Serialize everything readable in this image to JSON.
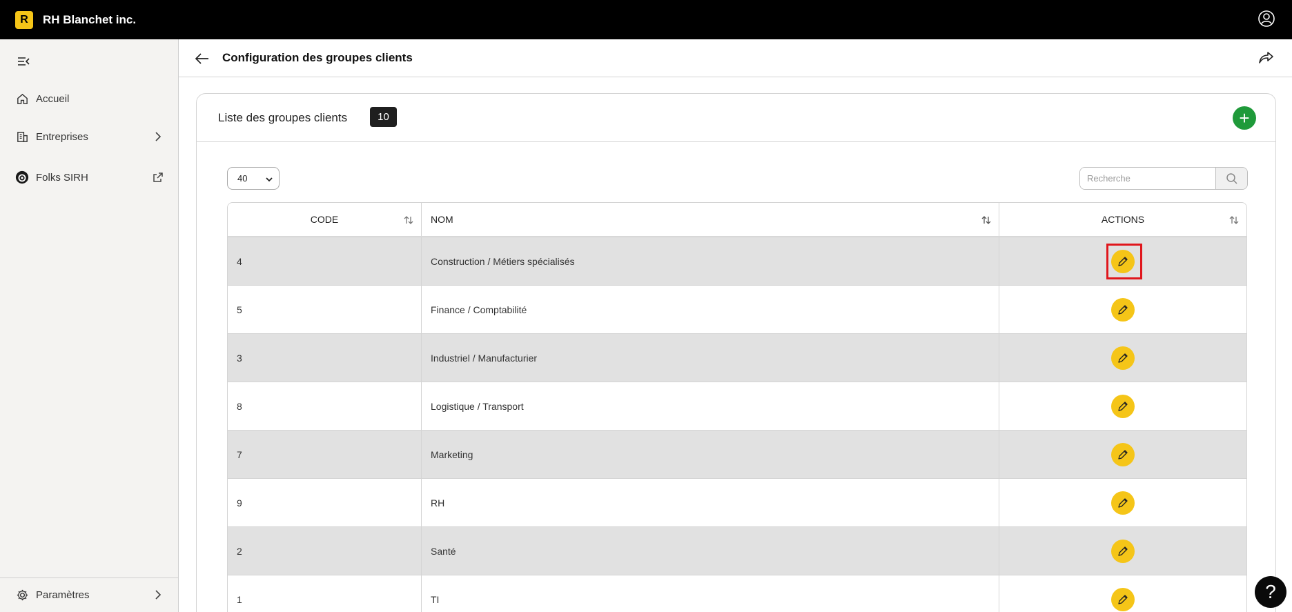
{
  "app": {
    "logo_letter": "R",
    "brand": "RH Blanchet inc."
  },
  "sidebar": {
    "items": [
      {
        "label": "Accueil"
      },
      {
        "label": "Entreprises"
      },
      {
        "label": "Folks SIRH"
      }
    ],
    "bottom": {
      "label": "Paramètres"
    }
  },
  "header": {
    "title": "Configuration des groupes clients"
  },
  "card": {
    "title": "Liste des groupes clients",
    "count": "10",
    "add_label": "+"
  },
  "controls": {
    "page_size": "40",
    "search_placeholder": "Recherche"
  },
  "table": {
    "columns": [
      "CODE",
      "NOM",
      "ACTIONS"
    ],
    "rows": [
      {
        "code": "4",
        "name": "Construction / Métiers spécialisés"
      },
      {
        "code": "5",
        "name": "Finance / Comptabilité"
      },
      {
        "code": "3",
        "name": "Industriel / Manufacturier"
      },
      {
        "code": "8",
        "name": "Logistique / Transport"
      },
      {
        "code": "7",
        "name": "Marketing"
      },
      {
        "code": "9",
        "name": "RH"
      },
      {
        "code": "2",
        "name": "Santé"
      },
      {
        "code": "1",
        "name": "TI"
      }
    ]
  },
  "help": {
    "label": "?"
  },
  "colors": {
    "accent_yellow": "#f5c518",
    "add_green": "#1f9a3a",
    "highlight_red": "#e0161c",
    "topbar": "#000000"
  }
}
